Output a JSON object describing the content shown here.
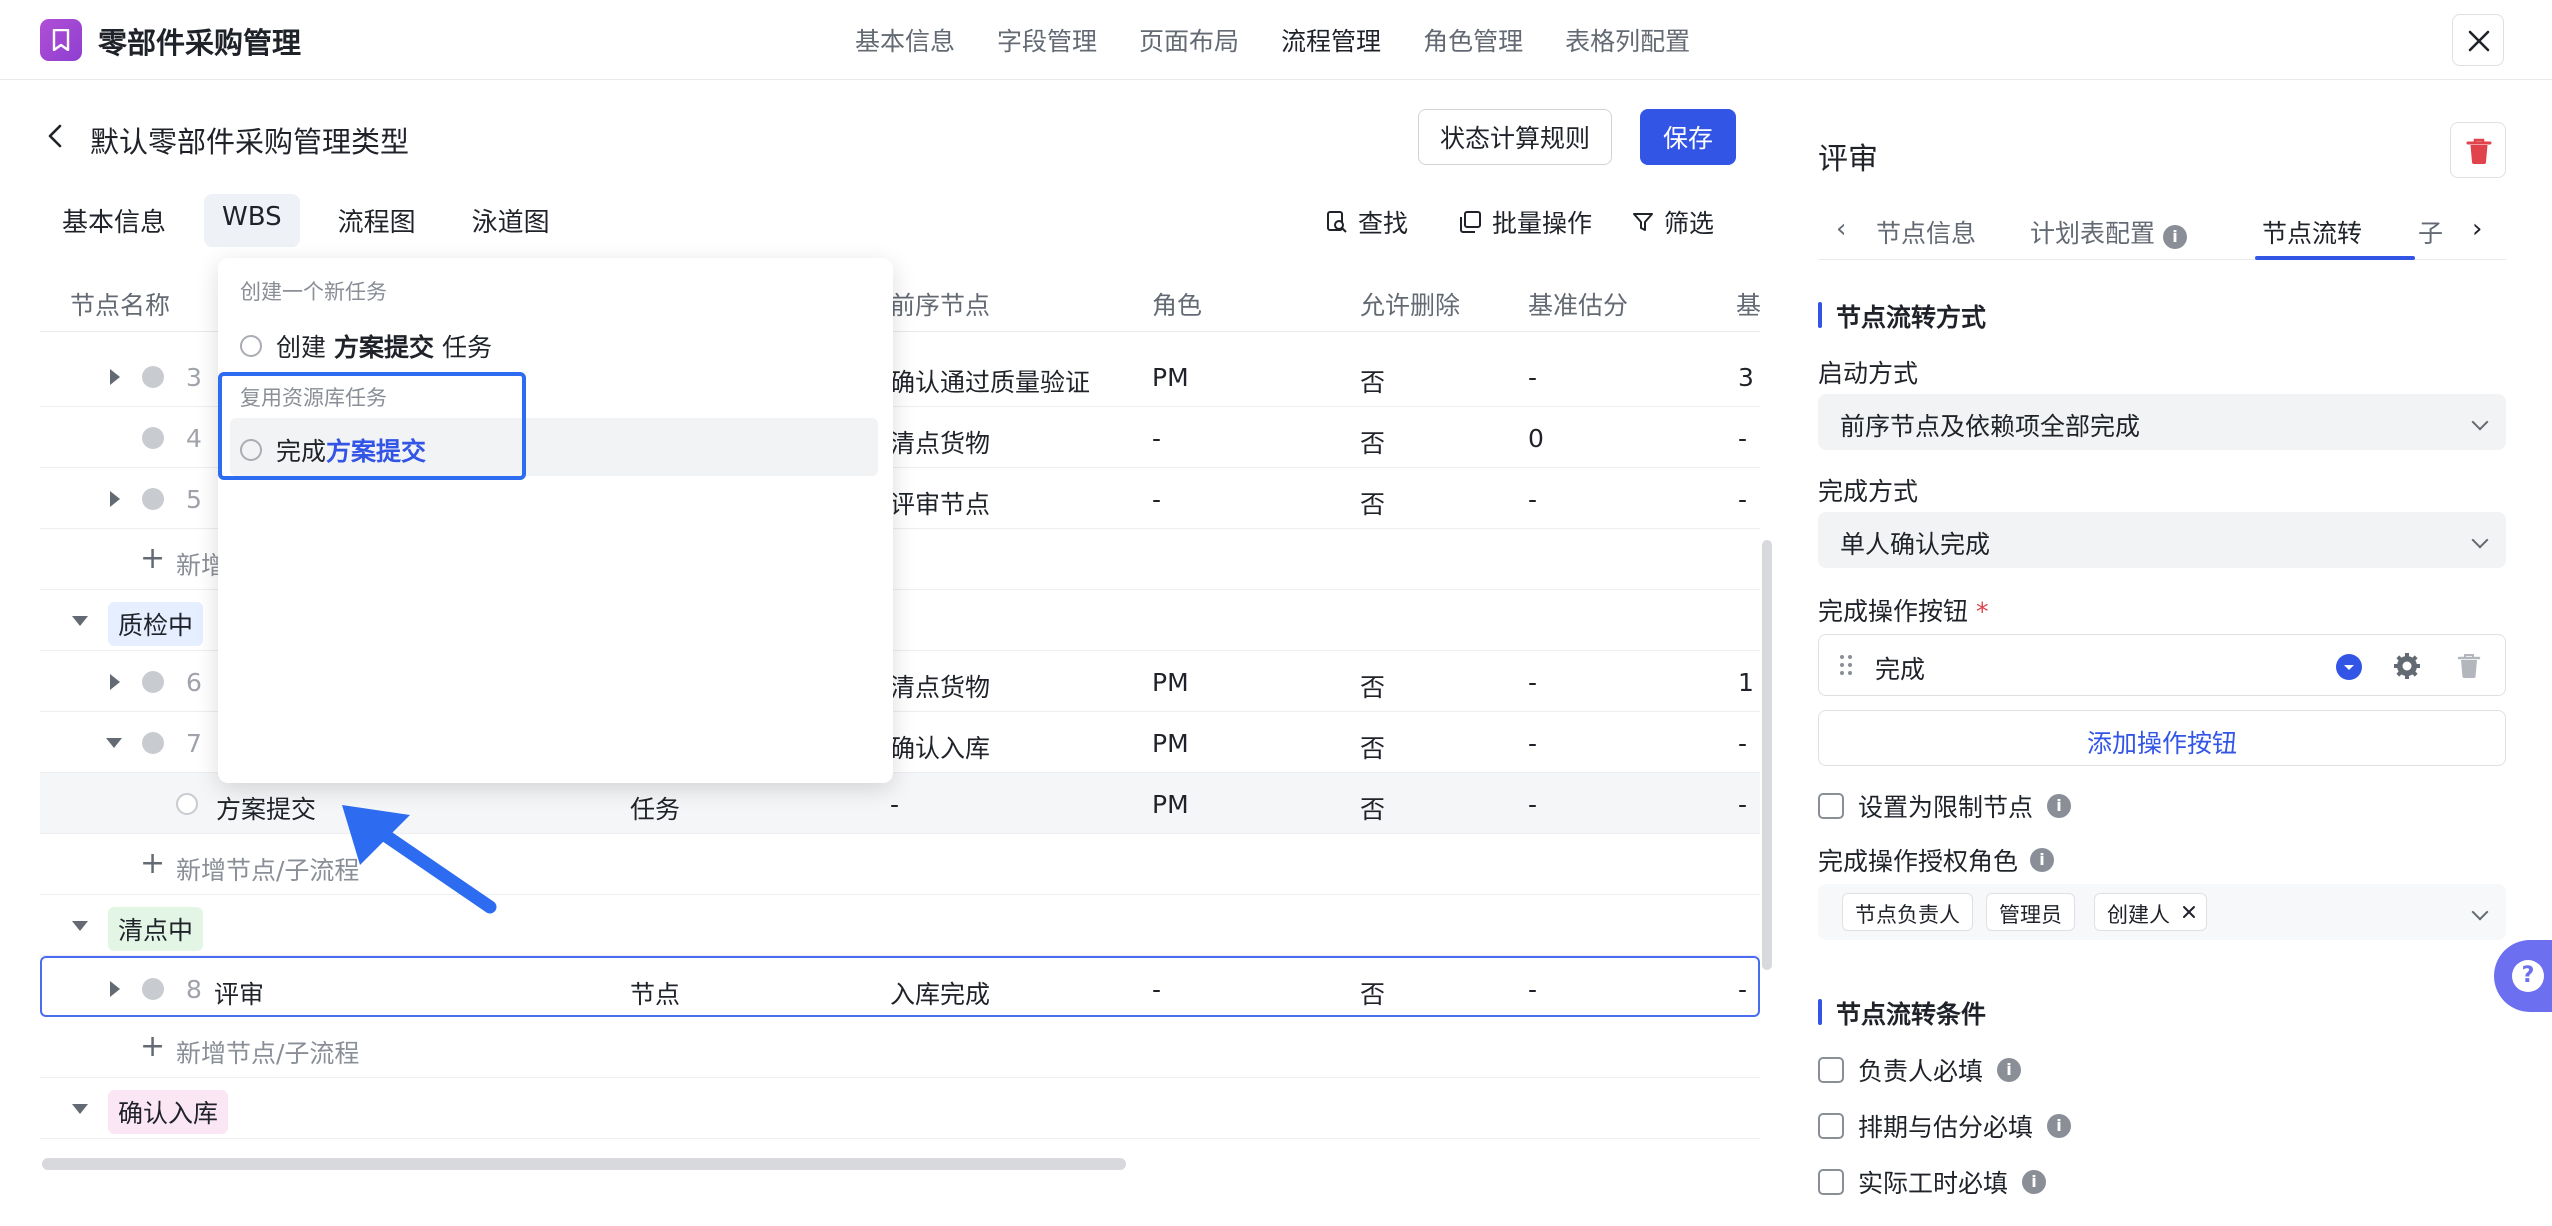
{
  "app": {
    "title": "零部件采购管理"
  },
  "topnav": [
    "基本信息",
    "字段管理",
    "页面布局",
    "流程管理",
    "角色管理",
    "表格列配置"
  ],
  "page": {
    "title": "默认零部件采购管理类型",
    "state_rules_btn": "状态计算规则",
    "save_btn": "保存"
  },
  "subtabs": [
    "基本信息",
    "WBS",
    "流程图",
    "泳道图"
  ],
  "toolbar": {
    "find": "查找",
    "batch": "批量操作",
    "filter": "筛选"
  },
  "table": {
    "headers": [
      "节点名称",
      "前序节点",
      "角色",
      "允许删除",
      "基准估分",
      "基"
    ],
    "rows": [
      {
        "num": "3",
        "c1": "确认通过质量验证",
        "c2": "PM",
        "c3": "否",
        "c4": "-",
        "c5": "3"
      },
      {
        "num": "4",
        "c1": "清点货物",
        "c2": "-",
        "c3": "否",
        "c4": "0",
        "c5": "-"
      },
      {
        "num": "5",
        "c1": "评审节点",
        "c2": "-",
        "c3": "否",
        "c4": "-",
        "c5": "-"
      },
      {
        "add": "新增"
      },
      {
        "group": "质检中"
      },
      {
        "num": "6",
        "c1": "清点货物",
        "c2": "PM",
        "c3": "否",
        "c4": "-",
        "c5": "1"
      },
      {
        "num": "7",
        "c1": "确认入库",
        "c2": "PM",
        "c3": "否",
        "c4": "-",
        "c5": "-"
      },
      {
        "name": "方案提交",
        "type": "任务",
        "c1": "-",
        "c2": "PM",
        "c3": "否",
        "c4": "-",
        "c5": "-"
      },
      {
        "add": "新增节点/子流程"
      },
      {
        "group": "清点中"
      },
      {
        "num": "8",
        "name": "评审",
        "type": "节点",
        "c1": "入库完成",
        "c2": "-",
        "c3": "否",
        "c4": "-",
        "c5": "-"
      },
      {
        "add": "新增节点/子流程"
      },
      {
        "group": "确认入库"
      }
    ]
  },
  "popup": {
    "section_new": "创建一个新任务",
    "create_prefix": "创建",
    "create_name": "方案提交",
    "create_suffix": "任务",
    "section_reuse": "复用资源库任务",
    "reuse_prefix": "完成",
    "reuse_name": "方案提交"
  },
  "right": {
    "title": "评审",
    "tabs": [
      "节点信息",
      "计划表配置",
      "节点流转",
      "子"
    ],
    "sec1": "节点流转方式",
    "start_label": "启动方式",
    "start_value": "前序节点及依赖项全部完成",
    "finish_label": "完成方式",
    "finish_value": "单人确认完成",
    "op_label": "完成操作按钮",
    "op_required": "*",
    "op_value": "完成",
    "add_op": "添加操作按钮",
    "limit_node": "设置为限制节点",
    "auth_label": "完成操作授权角色",
    "roles": [
      "节点负责人",
      "管理员",
      "创建人"
    ],
    "sec2": "节点流转条件",
    "cond": [
      "负责人必填",
      "排期与估分必填",
      "实际工时必填"
    ]
  },
  "colors": {
    "primary": "#3355e6",
    "danger": "#e0434b",
    "tag_blue": "#e6efff",
    "tag_green": "#e3f6e6",
    "tag_pink": "#fbe6f4"
  }
}
